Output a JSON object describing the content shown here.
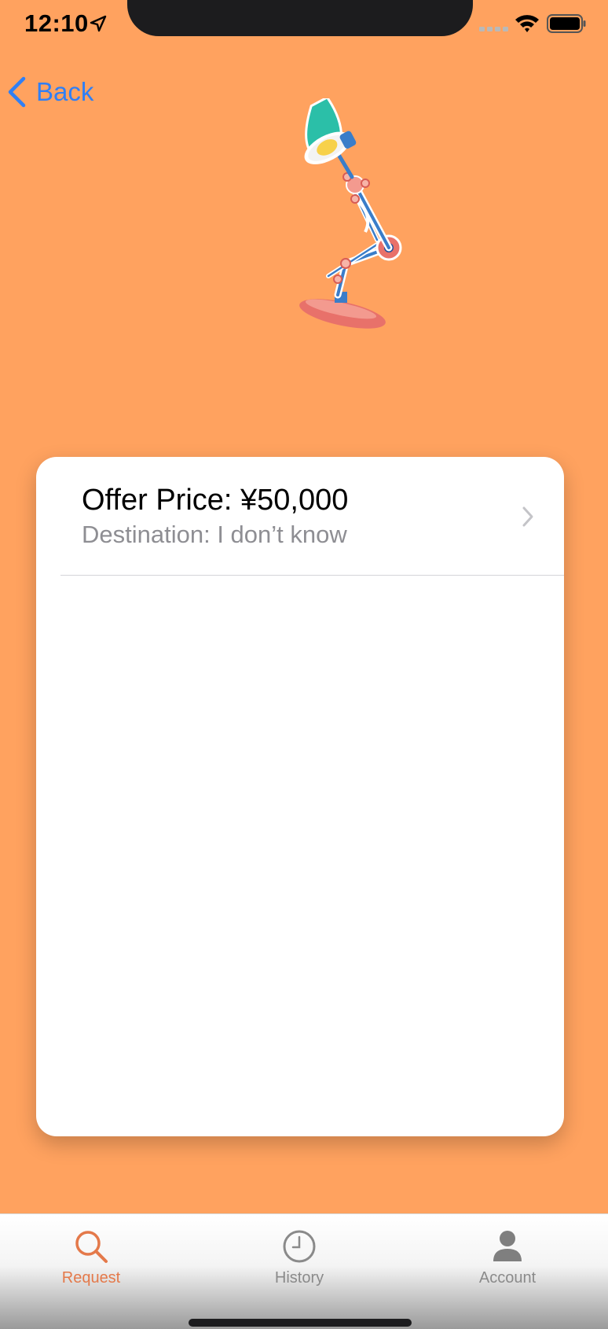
{
  "status_bar": {
    "time": "12:10"
  },
  "nav": {
    "back_label": "Back"
  },
  "offer": {
    "title": "Offer Price: ¥50,000",
    "subtitle": "Destination: I don’t know"
  },
  "tab_bar": {
    "tabs": [
      {
        "label": "Request",
        "icon": "search-icon",
        "selected": true
      },
      {
        "label": "History",
        "icon": "clock-icon",
        "selected": false
      },
      {
        "label": "Account",
        "icon": "person-icon",
        "selected": false
      }
    ]
  },
  "colors": {
    "background": "#ffa25f",
    "accent_blue": "#2f7ff6",
    "tab_selected": "#e4794a",
    "tab_unselected": "#8a8a8a"
  }
}
